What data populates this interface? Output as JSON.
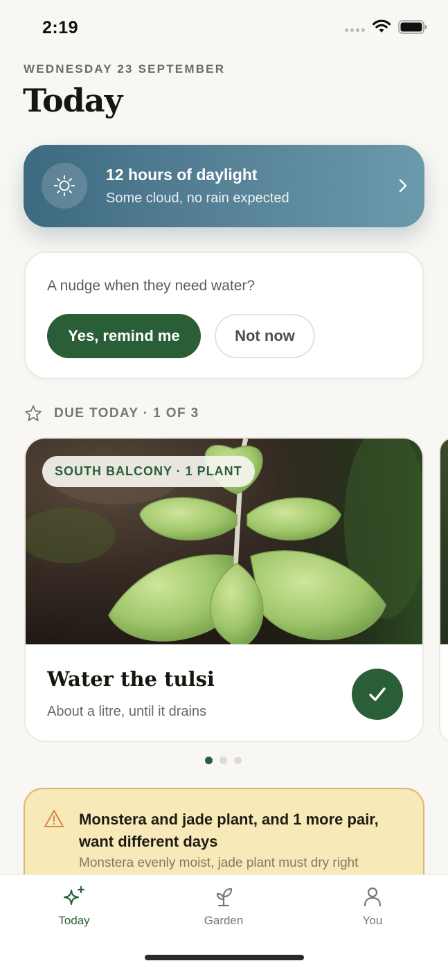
{
  "status_bar": {
    "time": "2:19"
  },
  "header": {
    "date": "WEDNESDAY 23 SEPTEMBER",
    "title": "Today"
  },
  "weather": {
    "title": "12 hours of daylight",
    "subtitle": "Some cloud, no rain expected",
    "icon": "sun-icon"
  },
  "nudge": {
    "question": "A nudge when they need water?",
    "yes_label": "Yes, remind me",
    "no_label": "Not now"
  },
  "due": {
    "label": "DUE TODAY · 1 OF 3",
    "icon": "star-icon"
  },
  "task": {
    "location": "SOUTH BALCONY · 1 PLANT",
    "title": "Water the tulsi",
    "subtitle": "About a litre, until it drains"
  },
  "pager": {
    "count": 3,
    "active": 1
  },
  "conflict": {
    "title": "Monstera and jade plant, and 1 more pair, want different days",
    "subtitle": "Monstera evenly moist, jade plant must dry right",
    "icon": "warning-icon"
  },
  "tabs": [
    {
      "label": "Today",
      "icon": "sparkle-icon",
      "active": true
    },
    {
      "label": "Garden",
      "icon": "sprout-icon",
      "active": false
    },
    {
      "label": "You",
      "icon": "person-icon",
      "active": false
    }
  ],
  "colors": {
    "accent": "#2a5e36",
    "weather_start": "#3d6a81",
    "weather_end": "#6a9aac",
    "warning_bg": "#f8e9b8",
    "warning_border": "#e0b27a"
  }
}
